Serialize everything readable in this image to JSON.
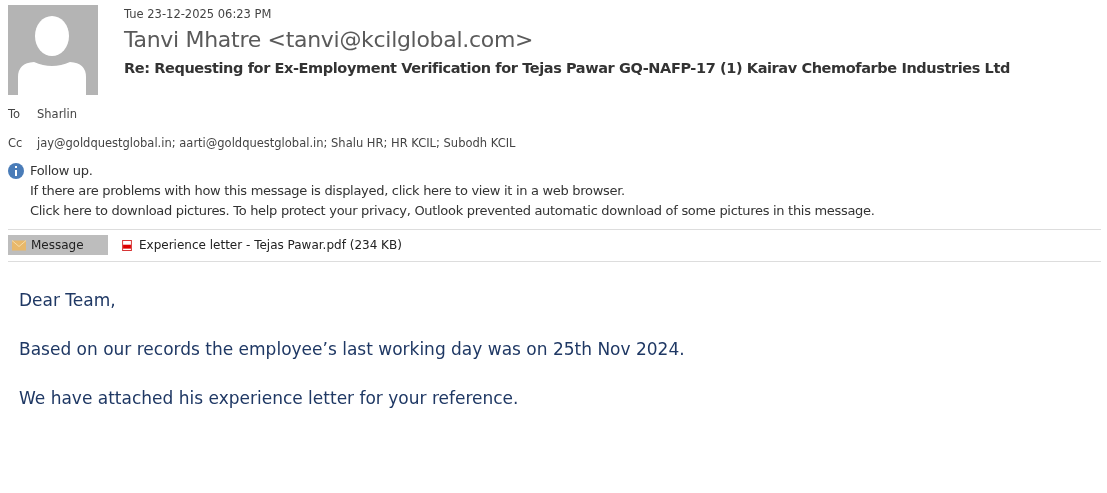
{
  "header": {
    "date": "Tue 23-12-2025 06:23 PM",
    "sender": "Tanvi Mhatre <tanvi@kcilglobal.com>",
    "subject": "Re: Requesting for Ex-Employment Verification for Tejas Pawar GQ-NAFP-17 (1) Kairav Chemofarbe Industries Ltd"
  },
  "recipients": [
    {
      "label": "To",
      "value": "Sharlin"
    },
    {
      "label": "Cc",
      "value": "jay@goldquestglobal.in; aarti@goldquestglobal.in; Shalu HR; HR KCIL; Subodh KCIL"
    }
  ],
  "info_bar": {
    "lines": [
      "Follow up.",
      "If there are problems with how this message is displayed, click here to view it in a web browser.",
      "Click here to download pictures. To help protect your privacy, Outlook prevented automatic download of some pictures in this message."
    ]
  },
  "tabs": [
    {
      "kind": "message",
      "label": "Message",
      "selected": true
    },
    {
      "kind": "attachment",
      "label": "Experience letter - Tejas Pawar.pdf (234 KB)",
      "selected": false
    }
  ],
  "body": [
    "Dear Team,",
    "Based on our records the employee’s last working day was on 25th Nov 2024.",
    "We have attached his experience letter for your reference."
  ]
}
